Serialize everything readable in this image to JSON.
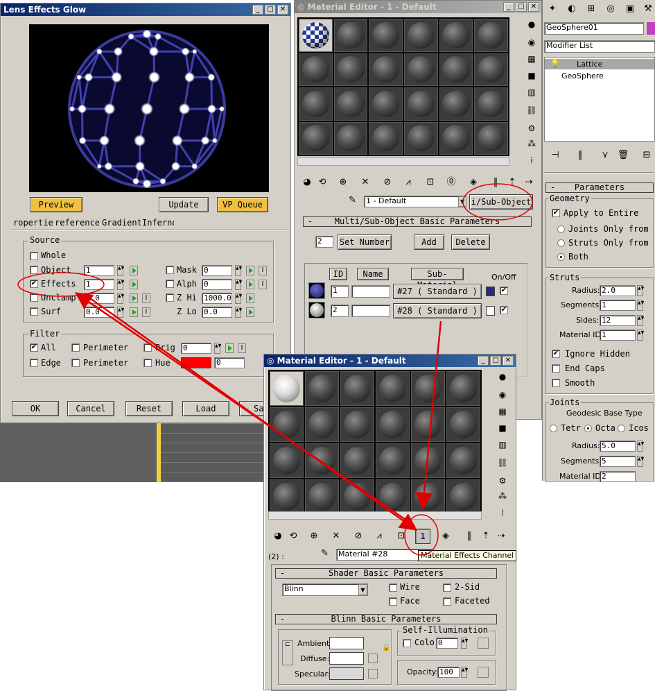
{
  "lens_window": {
    "title": "Lens Effects Glow",
    "preview_button": "Preview",
    "update_button": "Update",
    "vp_queue_button": "VP Queue",
    "tabs": [
      "ropertie",
      "reference",
      "Gradients",
      "Inferno"
    ],
    "source": {
      "title": "Source",
      "whole": "Whole",
      "object": "Object",
      "object_value": "1",
      "effects": "Effects",
      "effects_value": "1",
      "unclamp": "Unclamp",
      "unclamp_value": "1.0",
      "surf": "Surf",
      "surf_value": "0.0",
      "mask": "Mask",
      "mask_value": "0",
      "alph": "Alph",
      "alph_value": "0",
      "zhi": "Z Hi",
      "zhi_value": "1000.0",
      "zlo": "Z Lo",
      "zlo_value": "0.0",
      "i_label": "I"
    },
    "filter": {
      "title": "Filter",
      "all": "All",
      "edge": "Edge",
      "perimeter1": "Perimeter",
      "perimeter2": "Perimeter",
      "brig": "Brig",
      "brig_value": "0",
      "hue": "Hue",
      "hue_value": "0",
      "hue_color": "#ff0000"
    },
    "buttons": [
      "OK",
      "Cancel",
      "Reset",
      "Load",
      "Sa"
    ]
  },
  "mat_editor_back": {
    "title": "Material Editor - 1 - Default",
    "material_name": "1 - Default",
    "type_button": "i/Sub-Object",
    "rollout": "Multi/Sub-Object Basic Parameters",
    "count": "2",
    "set_number": "Set Number",
    "add": "Add",
    "delete": "Delete",
    "col_id": "ID",
    "col_name": "Name",
    "col_sub": "Sub-Material",
    "col_onoff": "On/Off",
    "rows": [
      {
        "id": "1",
        "sub": "#27  ( Standard )",
        "color": "#2a2a7a"
      },
      {
        "id": "2",
        "sub": "#28  ( Standard )",
        "color": "#ffffff"
      }
    ]
  },
  "command_panel": {
    "object_name": "GeoSphere01",
    "modifier_list": "Modifier List",
    "stack": [
      "Lattice",
      "GeoSphere"
    ],
    "parameters": "Parameters",
    "geometry": "Geometry",
    "apply_entire": "Apply to Entire",
    "joints_only": "Joints Only from",
    "struts_only": "Struts Only from",
    "both": "Both",
    "struts": "Struts",
    "radius_label": "Radius:",
    "radius_value": "2.0",
    "segments_label": "Segments:",
    "segments_value": "1",
    "sides_label": "Sides:",
    "sides_value": "12",
    "matid_label": "Material ID:",
    "matid_value": "1",
    "ignore_hidden": "Ignore Hidden",
    "end_caps": "End Caps",
    "smooth": "Smooth",
    "joints": "Joints",
    "geodesic": "Geodesic Base Type",
    "tetra": "Tetr",
    "octa": "Octa",
    "icos": "Icos",
    "j_radius_label": "Radius:",
    "j_radius_value": "5.0",
    "j_segments_label": "Segments:",
    "j_segments_value": "5",
    "j_matid_label": "Material ID:",
    "j_matid_value": "2"
  },
  "mat_editor_front": {
    "title": "Material Editor - 1 - Default",
    "level": "(2) :",
    "material_name": "Material #28",
    "tooltip": "Material Effects Channel",
    "channel_value": "1",
    "shader_rollout": "Shader Basic Parameters",
    "shader": "Blinn",
    "wire": "Wire",
    "two_sided": "2-Sid",
    "face": "Face",
    "faceted": "Faceted",
    "blinn_rollout": "Blinn Basic Parameters",
    "self_illum": "Self-Illumination",
    "color": "Colo",
    "color_value": "0",
    "ambient": "Ambient:",
    "diffuse": "Diffuse:",
    "specular": "Specular:",
    "opacity": "Opacity:",
    "opacity_value": "100"
  },
  "colors": {
    "annotation": "#e00000",
    "title_active": "#0a246a",
    "panel": "#d4d0c8"
  }
}
